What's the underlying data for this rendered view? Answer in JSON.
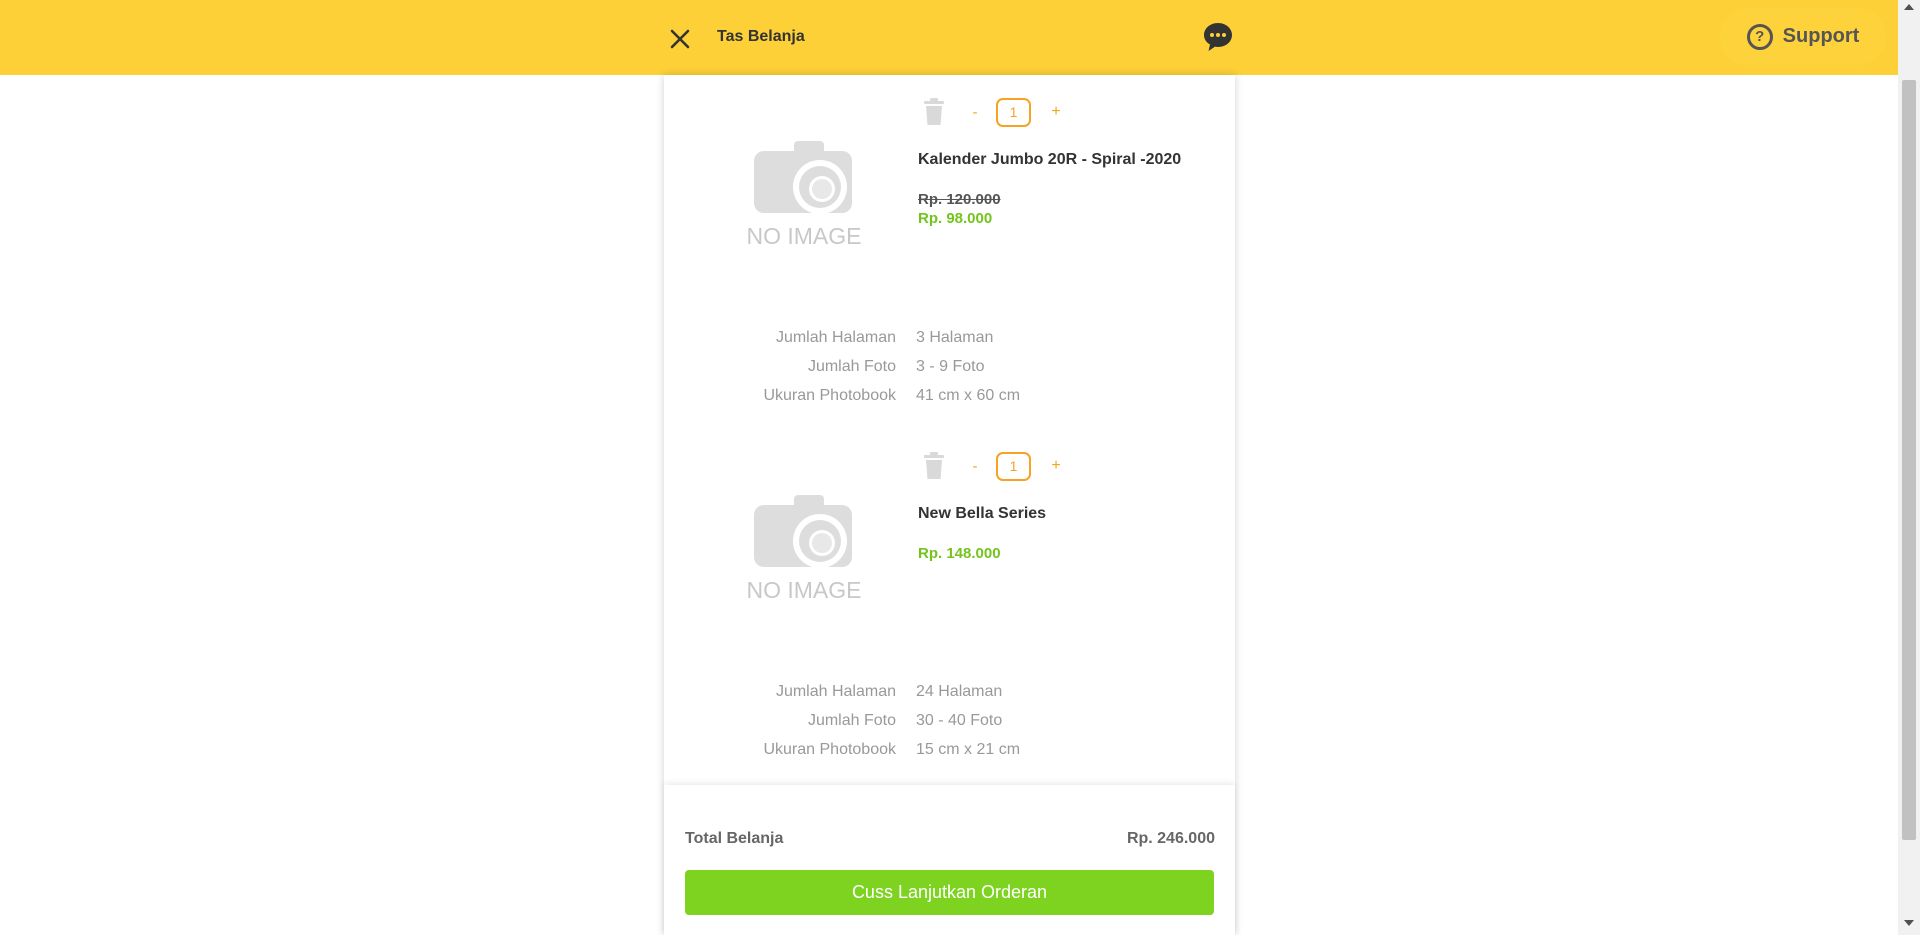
{
  "header": {
    "title": "Tas Belanja",
    "support_label": "Support",
    "close_icon": "close-icon",
    "chat_icon": "chat-bubble-icon",
    "support_icon": "question-circle-icon",
    "background_color": "#fdd037"
  },
  "cart": {
    "items": [
      {
        "name": "Kalender Jumbo 20R - Spiral -2020",
        "price_original": "Rp. 120.000",
        "price": "Rp. 98.000",
        "quantity": "1",
        "image_placeholder": "NO IMAGE",
        "qty_minus": "-",
        "qty_plus": "+",
        "specs": [
          {
            "label": "Jumlah Halaman",
            "value": "3 Halaman"
          },
          {
            "label": "Jumlah Foto",
            "value": "3 - 9 Foto"
          },
          {
            "label": "Ukuran Photobook",
            "value": "41 cm x 60 cm"
          }
        ]
      },
      {
        "name": "New Bella Series",
        "price": "Rp. 148.000",
        "quantity": "1",
        "image_placeholder": "NO IMAGE",
        "qty_minus": "-",
        "qty_plus": "+",
        "specs": [
          {
            "label": "Jumlah Halaman",
            "value": "24 Halaman"
          },
          {
            "label": "Jumlah Foto",
            "value": "30 - 40 Foto"
          },
          {
            "label": "Ukuran Photobook",
            "value": "15 cm x 21 cm"
          }
        ]
      }
    ],
    "accent_color": "#f7a321",
    "price_color": "#73c41d"
  },
  "footer": {
    "total_label": "Total Belanja",
    "total_value": "Rp. 246.000",
    "checkout_label": "Cuss Lanjutkan Orderan",
    "button_color": "#7ed321"
  }
}
